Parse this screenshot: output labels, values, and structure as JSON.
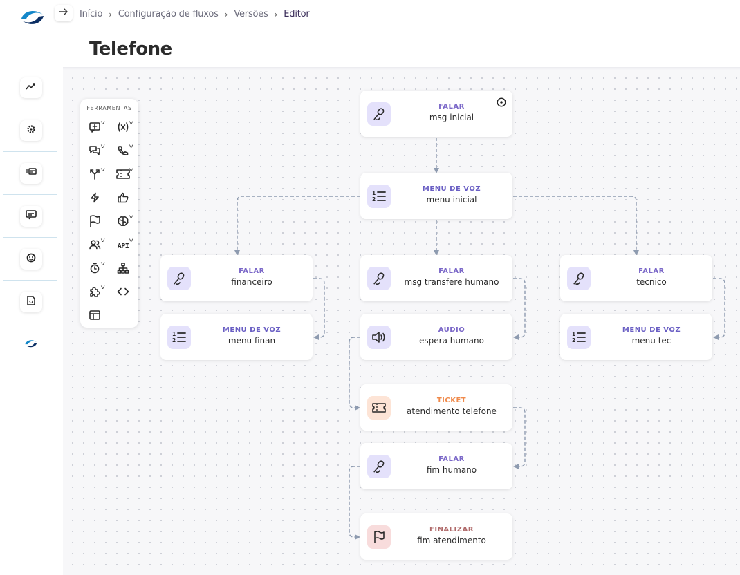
{
  "header": {
    "breadcrumb": [
      "Início",
      "Configuração de fluxos",
      "Versões",
      "Editor"
    ],
    "title": "Telefone"
  },
  "sidebar": {
    "items": [
      {
        "icon": "trend-chart-icon"
      },
      {
        "icon": "gear-icon"
      },
      {
        "icon": "message-list-icon"
      },
      {
        "icon": "chat-monitor-icon"
      },
      {
        "icon": "headset-icon"
      },
      {
        "icon": "file-code-icon"
      },
      {
        "icon": "brand-logo-icon"
      }
    ]
  },
  "toolbox": {
    "title": "FERRAMENTAS",
    "tools": [
      {
        "icon": "add-message-icon",
        "has_menu": true
      },
      {
        "icon": "variable-icon",
        "has_menu": true
      },
      {
        "icon": "chat-bubbles-icon",
        "has_menu": true
      },
      {
        "icon": "phone-icon",
        "has_menu": true
      },
      {
        "icon": "split-arrows-icon",
        "has_menu": true
      },
      {
        "icon": "ticket-icon",
        "has_menu": true
      },
      {
        "icon": "lightning-icon",
        "has_menu": false
      },
      {
        "icon": "thumbs-up-icon",
        "has_menu": false
      },
      {
        "icon": "flag-icon",
        "has_menu": false
      },
      {
        "icon": "brain-icon",
        "has_menu": true
      },
      {
        "icon": "users-icon",
        "has_menu": true
      },
      {
        "icon": "api-icon",
        "has_menu": true,
        "text": "API"
      },
      {
        "icon": "timer-icon",
        "has_menu": true
      },
      {
        "icon": "hierarchy-icon",
        "has_menu": false
      },
      {
        "icon": "puzzle-icon",
        "has_menu": true
      },
      {
        "icon": "code-icon",
        "has_menu": false
      },
      {
        "icon": "table-icon",
        "has_menu": false
      }
    ]
  },
  "colors": {
    "falar": "#7b68c8",
    "menu": "#6a5fc4",
    "audio": "#7b68c8",
    "ticket": "#f08a4b",
    "finalizar": "#b06a6a",
    "icon_bg_purple": "#e4e1fb",
    "icon_bg_ticket": "#fde4d6",
    "icon_bg_final": "#f8dcdc",
    "edge": "#8e9bb0"
  },
  "nodes": [
    {
      "id": "msg-inicial",
      "type": "FALAR",
      "name": "msg inicial",
      "icon": "microphone-icon",
      "start": true
    },
    {
      "id": "menu-inicial",
      "type": "MENU DE VOZ",
      "name": "menu inicial",
      "icon": "numbered-list-icon"
    },
    {
      "id": "financeiro",
      "type": "FALAR",
      "name": "financeiro",
      "icon": "microphone-icon"
    },
    {
      "id": "msg-transfere",
      "type": "FALAR",
      "name": "msg transfere humano",
      "icon": "microphone-icon"
    },
    {
      "id": "tecnico",
      "type": "FALAR",
      "name": "tecnico",
      "icon": "microphone-icon"
    },
    {
      "id": "menu-finan",
      "type": "MENU DE VOZ",
      "name": "menu finan",
      "icon": "numbered-list-icon"
    },
    {
      "id": "espera-humano",
      "type": "ÁUDIO",
      "name": "espera humano",
      "icon": "speaker-icon"
    },
    {
      "id": "menu-tec",
      "type": "MENU DE VOZ",
      "name": "menu tec",
      "icon": "numbered-list-icon"
    },
    {
      "id": "atendimento-telefone",
      "type": "TICKET",
      "name": "atendimento telefone",
      "icon": "ticket-icon"
    },
    {
      "id": "fim-humano",
      "type": "FALAR",
      "name": "fim humano",
      "icon": "microphone-icon"
    },
    {
      "id": "fim-atendimento",
      "type": "FINALIZAR",
      "name": "fim atendimento",
      "icon": "flag-icon"
    }
  ]
}
